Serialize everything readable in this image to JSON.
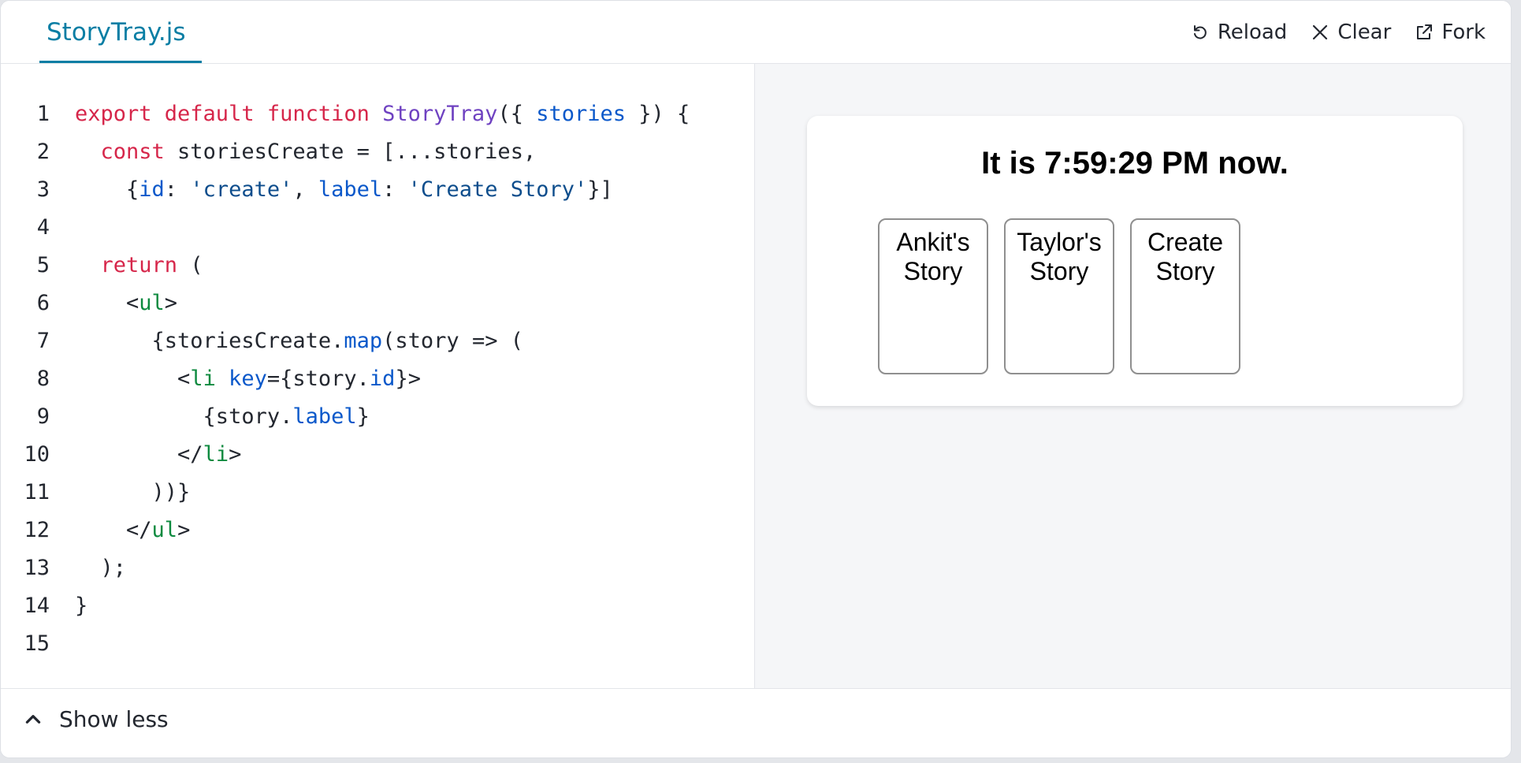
{
  "tab": {
    "label": "StoryTray.js"
  },
  "actions": {
    "reload": "Reload",
    "clear": "Clear",
    "fork": "Fork"
  },
  "code": {
    "line_numbers": [
      "1",
      "2",
      "3",
      "4",
      "5",
      "6",
      "7",
      "8",
      "9",
      "10",
      "11",
      "12",
      "13",
      "14",
      "15"
    ],
    "tokens": [
      [
        [
          "kw",
          "export default function "
        ],
        [
          "fn",
          "StoryTray"
        ],
        [
          "",
          "({ "
        ],
        [
          "pr",
          "stories"
        ],
        [
          "",
          " }) {"
        ]
      ],
      [
        [
          "",
          "  "
        ],
        [
          "kw",
          "const"
        ],
        [
          "",
          " storiesCreate = [...stories,"
        ]
      ],
      [
        [
          "",
          "    {"
        ],
        [
          "pr",
          "id"
        ],
        [
          "",
          ": "
        ],
        [
          "st",
          "'create'"
        ],
        [
          "",
          ", "
        ],
        [
          "pr",
          "label"
        ],
        [
          "",
          ": "
        ],
        [
          "st",
          "'Create Story'"
        ],
        [
          "",
          "}]"
        ]
      ],
      [],
      [
        [
          "",
          "  "
        ],
        [
          "kw",
          "return"
        ],
        [
          "",
          " ("
        ]
      ],
      [
        [
          "",
          "    <"
        ],
        [
          "tg",
          "ul"
        ],
        [
          "",
          ">"
        ]
      ],
      [
        [
          "",
          "      {storiesCreate."
        ],
        [
          "pr",
          "map"
        ],
        [
          "",
          "(story => ("
        ]
      ],
      [
        [
          "",
          "        <"
        ],
        [
          "tg",
          "li"
        ],
        [
          "",
          " "
        ],
        [
          "pr",
          "key"
        ],
        [
          "",
          "={story."
        ],
        [
          "pr",
          "id"
        ],
        [
          "",
          "}>"
        ]
      ],
      [
        [
          "",
          "          {story."
        ],
        [
          "pr",
          "label"
        ],
        [
          "",
          "}"
        ]
      ],
      [
        [
          "",
          "        </"
        ],
        [
          "tg",
          "li"
        ],
        [
          "",
          ">"
        ]
      ],
      [
        [
          "",
          "      ))}"
        ]
      ],
      [
        [
          "",
          "    </"
        ],
        [
          "tg",
          "ul"
        ],
        [
          "",
          ">"
        ]
      ],
      [
        [
          "",
          "  );"
        ]
      ],
      [
        [
          "",
          "}"
        ]
      ],
      []
    ]
  },
  "preview": {
    "clock": "It is 7:59:29 PM now.",
    "stories": [
      {
        "label": "Ankit's Story"
      },
      {
        "label": "Taylor's Story"
      },
      {
        "label": "Create Story"
      }
    ]
  },
  "footer": {
    "toggle_label": "Show less"
  },
  "colors": {
    "accent": "#087ea4",
    "keyword": "#d6264a",
    "function": "#6f42c1",
    "property": "#0a58ca",
    "string": "#0d4d8c",
    "tag": "#0d8a3f"
  },
  "icons": {
    "reload": "reload-icon",
    "clear": "close-icon",
    "fork": "external-link-icon",
    "toggle": "chevron-up-icon"
  }
}
